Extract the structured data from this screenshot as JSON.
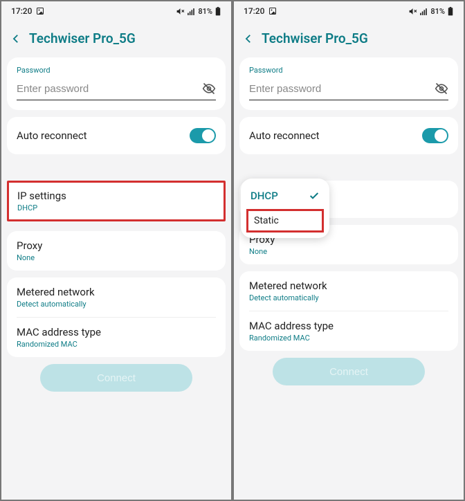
{
  "status": {
    "time": "17:20",
    "battery": "81%"
  },
  "header": {
    "title": "Techwiser Pro_5G"
  },
  "password": {
    "label": "Password",
    "placeholder": "Enter password"
  },
  "autoReconnect": {
    "label": "Auto reconnect"
  },
  "ipSettings": {
    "title": "IP settings",
    "value": "DHCP"
  },
  "proxy": {
    "title": "Proxy",
    "value": "None"
  },
  "metered": {
    "title": "Metered network",
    "value": "Detect automatically"
  },
  "mac": {
    "title": "MAC address type",
    "value": "Randomized MAC"
  },
  "connect": {
    "label": "Connect"
  },
  "dropdown": {
    "selected": "DHCP",
    "option": "Static"
  }
}
